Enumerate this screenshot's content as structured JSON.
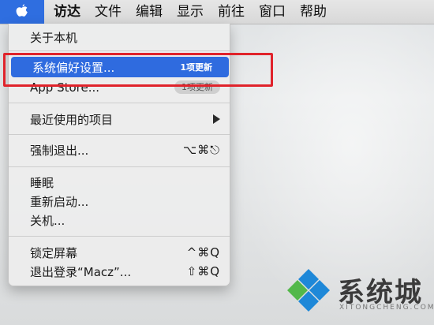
{
  "menubar": {
    "apple_icon": "apple-logo-icon",
    "items": [
      "访达",
      "文件",
      "编辑",
      "显示",
      "前往",
      "窗口",
      "帮助"
    ]
  },
  "apple_menu": {
    "about": "关于本机",
    "system_prefs": {
      "label": "系统偏好设置...",
      "badge": "1项更新"
    },
    "app_store": {
      "label": "App Store...",
      "badge": "1项更新"
    },
    "recent_items": {
      "label": "最近使用的项目",
      "submenu_icon": "chevron-right-icon"
    },
    "force_quit": {
      "label": "强制退出...",
      "shortcut": "⌥⌘⎋"
    },
    "sleep": "睡眠",
    "restart": "重新启动...",
    "shutdown": "关机...",
    "lock_screen": {
      "label": "锁定屏幕",
      "shortcut": "^⌘Q"
    },
    "logout": {
      "label": "退出登录“Macz”...",
      "shortcut": "⇧⌘Q"
    }
  },
  "colors": {
    "highlight": "#2f6bdf",
    "annotation": "#e0232b",
    "watermark_blue": "#1e88d8",
    "watermark_green": "#53b84a"
  },
  "watermark": {
    "title": "系统城",
    "subtitle": "XITONGCHENG.COM"
  }
}
